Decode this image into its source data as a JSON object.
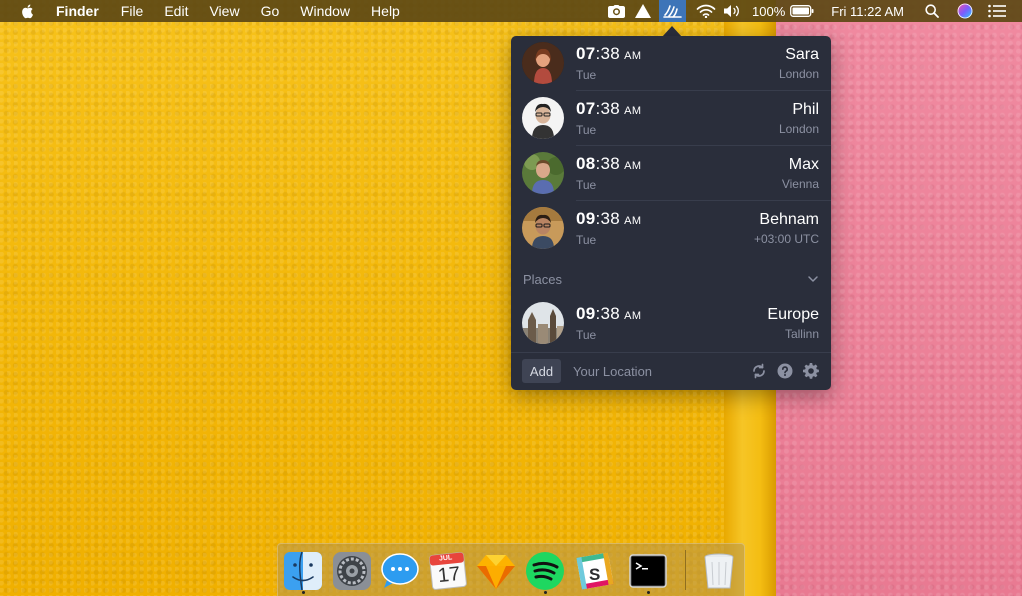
{
  "menubar": {
    "app_name": "Finder",
    "items": [
      "File",
      "Edit",
      "View",
      "Go",
      "Window",
      "Help"
    ],
    "status_icons": [
      "camera-icon",
      "drive-upload-icon",
      "timezone-app-icon",
      "wifi-icon",
      "volume-icon"
    ],
    "battery_percent": "100%",
    "clock": "Fri 11:22 AM"
  },
  "popover": {
    "people": [
      {
        "hour": "07",
        "minutes": ":38",
        "ampm": "AM",
        "day": "Tue",
        "name": "Sara",
        "location": "London"
      },
      {
        "hour": "07",
        "minutes": ":38",
        "ampm": "AM",
        "day": "Tue",
        "name": "Phil",
        "location": "London"
      },
      {
        "hour": "08",
        "minutes": ":38",
        "ampm": "AM",
        "day": "Tue",
        "name": "Max",
        "location": "Vienna"
      },
      {
        "hour": "09",
        "minutes": ":38",
        "ampm": "AM",
        "day": "Tue",
        "name": "Behnam",
        "location": "+03:00 UTC"
      }
    ],
    "places_label": "Places",
    "places": [
      {
        "hour": "09",
        "minutes": ":38",
        "ampm": "AM",
        "day": "Tue",
        "name": "Europe",
        "location": "Tallinn"
      }
    ],
    "footer": {
      "add_label": "Add",
      "location_placeholder": "Your Location"
    }
  },
  "dock": {
    "apps": [
      "Finder",
      "System Preferences",
      "Messages",
      "Calendar",
      "Sketch",
      "Spotify",
      "Slack",
      "Terminal",
      "Trash"
    ],
    "calendar_month": "JUL",
    "calendar_day": "17"
  },
  "colors": {
    "popover_bg": "#2a2e3b",
    "menubar_bg": "#5c4814",
    "accent_active": "#3e75b8",
    "secondary_text": "#8c91a2"
  }
}
